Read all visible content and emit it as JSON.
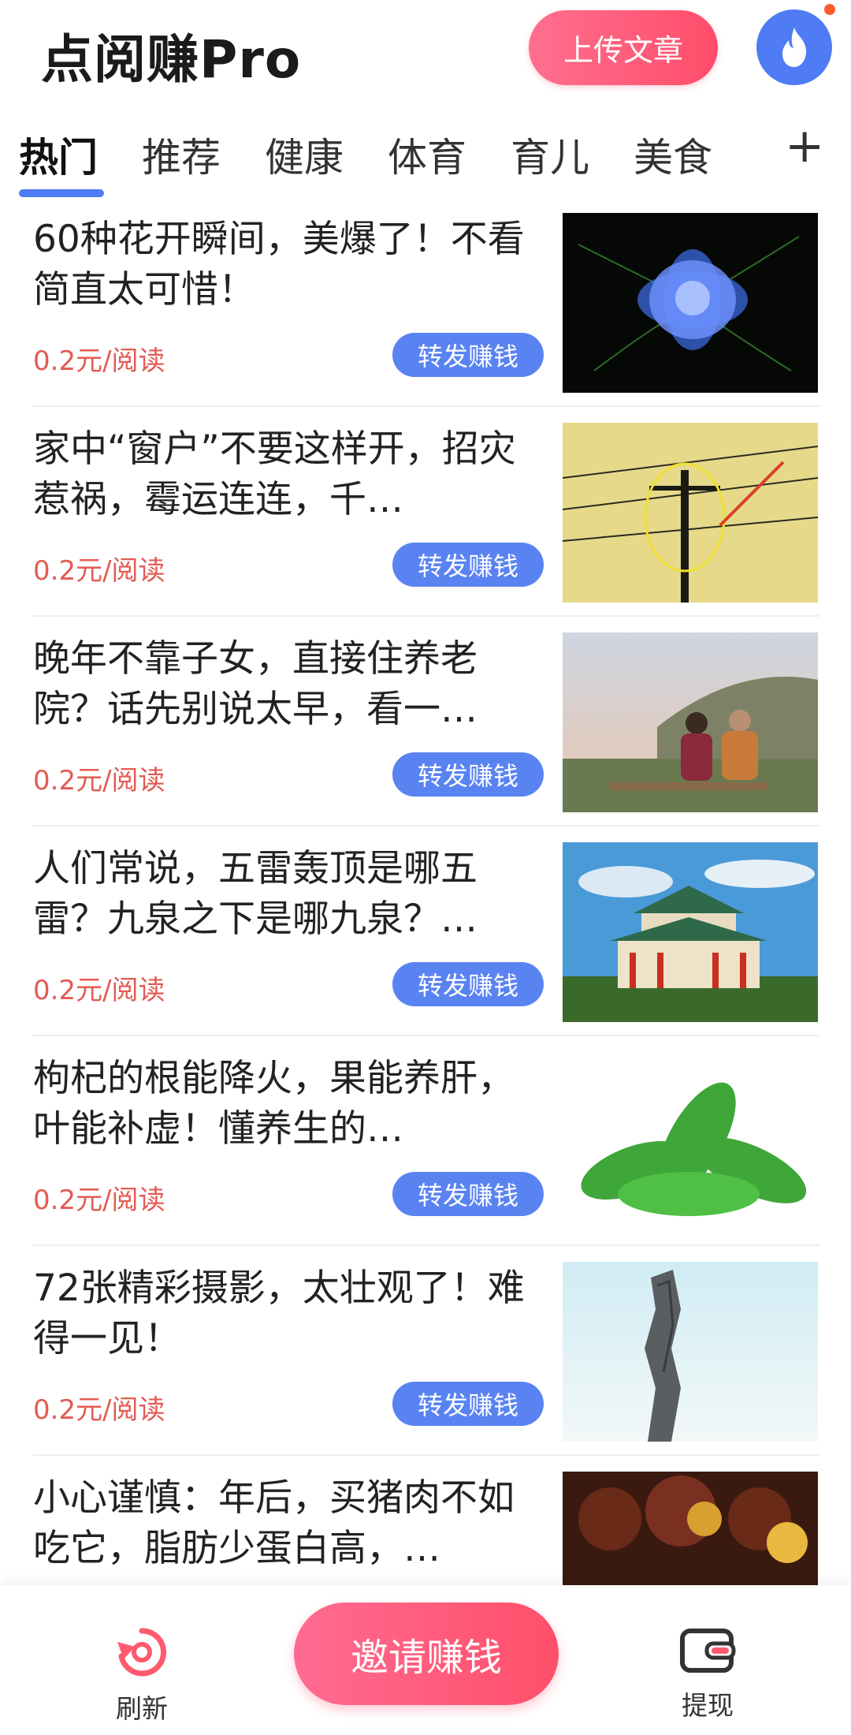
{
  "header": {
    "app_title": "点阅赚Pro",
    "upload_label": "上传文章",
    "hot_icon": "flame-icon",
    "accent_color": "#4f7cf4",
    "brand_pink": "#ff4d6a"
  },
  "tabs": {
    "items": [
      {
        "label": "热门",
        "active": true
      },
      {
        "label": "推荐",
        "active": false
      },
      {
        "label": "健康",
        "active": false
      },
      {
        "label": "体育",
        "active": false
      },
      {
        "label": "育儿",
        "active": false
      },
      {
        "label": "美食",
        "active": false
      }
    ],
    "add_label": "+"
  },
  "feed": {
    "articles": [
      {
        "title": "60种花开瞬间，美爆了！不看简直太可惜！",
        "price": "0.2元/阅读",
        "share_label": "转发赚钱"
      },
      {
        "title": "家中“窗户”不要这样开，招灾惹祸，霉运连连，千…",
        "price": "0.2元/阅读",
        "share_label": "转发赚钱"
      },
      {
        "title": "晚年不靠子女，直接住养老院？话先别说太早，看一…",
        "price": "0.2元/阅读",
        "share_label": "转发赚钱"
      },
      {
        "title": "人们常说，五雷轰顶是哪五雷？九泉之下是哪九泉？…",
        "price": "0.2元/阅读",
        "share_label": "转发赚钱"
      },
      {
        "title": "枸杞的根能降火，果能养肝，叶能补虚！懂养生的…",
        "price": "0.2元/阅读",
        "share_label": "转发赚钱"
      },
      {
        "title": "72张精彩摄影，太壮观了！难得一见！",
        "price": "0.2元/阅读",
        "share_label": "转发赚钱"
      },
      {
        "title": "小心谨慎：年后，买猪肉不如吃它，脂肪少蛋白高，…",
        "price": "",
        "share_label": ""
      }
    ]
  },
  "bottom_bar": {
    "refresh_label": "刷新",
    "invite_label": "邀请赚钱",
    "withdraw_label": "提现"
  }
}
